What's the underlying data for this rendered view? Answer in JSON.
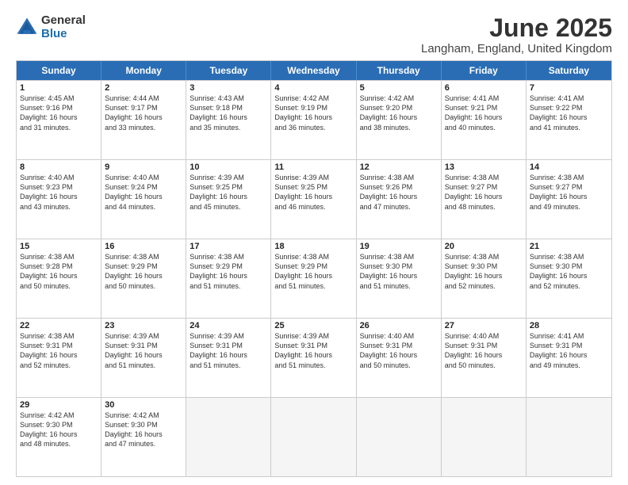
{
  "logo": {
    "general": "General",
    "blue": "Blue"
  },
  "title": "June 2025",
  "subtitle": "Langham, England, United Kingdom",
  "headers": [
    "Sunday",
    "Monday",
    "Tuesday",
    "Wednesday",
    "Thursday",
    "Friday",
    "Saturday"
  ],
  "rows": [
    [
      {
        "day": "1",
        "lines": [
          "Sunrise: 4:45 AM",
          "Sunset: 9:16 PM",
          "Daylight: 16 hours",
          "and 31 minutes."
        ]
      },
      {
        "day": "2",
        "lines": [
          "Sunrise: 4:44 AM",
          "Sunset: 9:17 PM",
          "Daylight: 16 hours",
          "and 33 minutes."
        ]
      },
      {
        "day": "3",
        "lines": [
          "Sunrise: 4:43 AM",
          "Sunset: 9:18 PM",
          "Daylight: 16 hours",
          "and 35 minutes."
        ]
      },
      {
        "day": "4",
        "lines": [
          "Sunrise: 4:42 AM",
          "Sunset: 9:19 PM",
          "Daylight: 16 hours",
          "and 36 minutes."
        ]
      },
      {
        "day": "5",
        "lines": [
          "Sunrise: 4:42 AM",
          "Sunset: 9:20 PM",
          "Daylight: 16 hours",
          "and 38 minutes."
        ]
      },
      {
        "day": "6",
        "lines": [
          "Sunrise: 4:41 AM",
          "Sunset: 9:21 PM",
          "Daylight: 16 hours",
          "and 40 minutes."
        ]
      },
      {
        "day": "7",
        "lines": [
          "Sunrise: 4:41 AM",
          "Sunset: 9:22 PM",
          "Daylight: 16 hours",
          "and 41 minutes."
        ]
      }
    ],
    [
      {
        "day": "8",
        "lines": [
          "Sunrise: 4:40 AM",
          "Sunset: 9:23 PM",
          "Daylight: 16 hours",
          "and 43 minutes."
        ]
      },
      {
        "day": "9",
        "lines": [
          "Sunrise: 4:40 AM",
          "Sunset: 9:24 PM",
          "Daylight: 16 hours",
          "and 44 minutes."
        ]
      },
      {
        "day": "10",
        "lines": [
          "Sunrise: 4:39 AM",
          "Sunset: 9:25 PM",
          "Daylight: 16 hours",
          "and 45 minutes."
        ]
      },
      {
        "day": "11",
        "lines": [
          "Sunrise: 4:39 AM",
          "Sunset: 9:25 PM",
          "Daylight: 16 hours",
          "and 46 minutes."
        ]
      },
      {
        "day": "12",
        "lines": [
          "Sunrise: 4:38 AM",
          "Sunset: 9:26 PM",
          "Daylight: 16 hours",
          "and 47 minutes."
        ]
      },
      {
        "day": "13",
        "lines": [
          "Sunrise: 4:38 AM",
          "Sunset: 9:27 PM",
          "Daylight: 16 hours",
          "and 48 minutes."
        ]
      },
      {
        "day": "14",
        "lines": [
          "Sunrise: 4:38 AM",
          "Sunset: 9:27 PM",
          "Daylight: 16 hours",
          "and 49 minutes."
        ]
      }
    ],
    [
      {
        "day": "15",
        "lines": [
          "Sunrise: 4:38 AM",
          "Sunset: 9:28 PM",
          "Daylight: 16 hours",
          "and 50 minutes."
        ]
      },
      {
        "day": "16",
        "lines": [
          "Sunrise: 4:38 AM",
          "Sunset: 9:29 PM",
          "Daylight: 16 hours",
          "and 50 minutes."
        ]
      },
      {
        "day": "17",
        "lines": [
          "Sunrise: 4:38 AM",
          "Sunset: 9:29 PM",
          "Daylight: 16 hours",
          "and 51 minutes."
        ]
      },
      {
        "day": "18",
        "lines": [
          "Sunrise: 4:38 AM",
          "Sunset: 9:29 PM",
          "Daylight: 16 hours",
          "and 51 minutes."
        ]
      },
      {
        "day": "19",
        "lines": [
          "Sunrise: 4:38 AM",
          "Sunset: 9:30 PM",
          "Daylight: 16 hours",
          "and 51 minutes."
        ]
      },
      {
        "day": "20",
        "lines": [
          "Sunrise: 4:38 AM",
          "Sunset: 9:30 PM",
          "Daylight: 16 hours",
          "and 52 minutes."
        ]
      },
      {
        "day": "21",
        "lines": [
          "Sunrise: 4:38 AM",
          "Sunset: 9:30 PM",
          "Daylight: 16 hours",
          "and 52 minutes."
        ]
      }
    ],
    [
      {
        "day": "22",
        "lines": [
          "Sunrise: 4:38 AM",
          "Sunset: 9:31 PM",
          "Daylight: 16 hours",
          "and 52 minutes."
        ]
      },
      {
        "day": "23",
        "lines": [
          "Sunrise: 4:39 AM",
          "Sunset: 9:31 PM",
          "Daylight: 16 hours",
          "and 51 minutes."
        ]
      },
      {
        "day": "24",
        "lines": [
          "Sunrise: 4:39 AM",
          "Sunset: 9:31 PM",
          "Daylight: 16 hours",
          "and 51 minutes."
        ]
      },
      {
        "day": "25",
        "lines": [
          "Sunrise: 4:39 AM",
          "Sunset: 9:31 PM",
          "Daylight: 16 hours",
          "and 51 minutes."
        ]
      },
      {
        "day": "26",
        "lines": [
          "Sunrise: 4:40 AM",
          "Sunset: 9:31 PM",
          "Daylight: 16 hours",
          "and 50 minutes."
        ]
      },
      {
        "day": "27",
        "lines": [
          "Sunrise: 4:40 AM",
          "Sunset: 9:31 PM",
          "Daylight: 16 hours",
          "and 50 minutes."
        ]
      },
      {
        "day": "28",
        "lines": [
          "Sunrise: 4:41 AM",
          "Sunset: 9:31 PM",
          "Daylight: 16 hours",
          "and 49 minutes."
        ]
      }
    ],
    [
      {
        "day": "29",
        "lines": [
          "Sunrise: 4:42 AM",
          "Sunset: 9:30 PM",
          "Daylight: 16 hours",
          "and 48 minutes."
        ]
      },
      {
        "day": "30",
        "lines": [
          "Sunrise: 4:42 AM",
          "Sunset: 9:30 PM",
          "Daylight: 16 hours",
          "and 47 minutes."
        ]
      },
      {
        "day": "",
        "lines": []
      },
      {
        "day": "",
        "lines": []
      },
      {
        "day": "",
        "lines": []
      },
      {
        "day": "",
        "lines": []
      },
      {
        "day": "",
        "lines": []
      }
    ]
  ]
}
